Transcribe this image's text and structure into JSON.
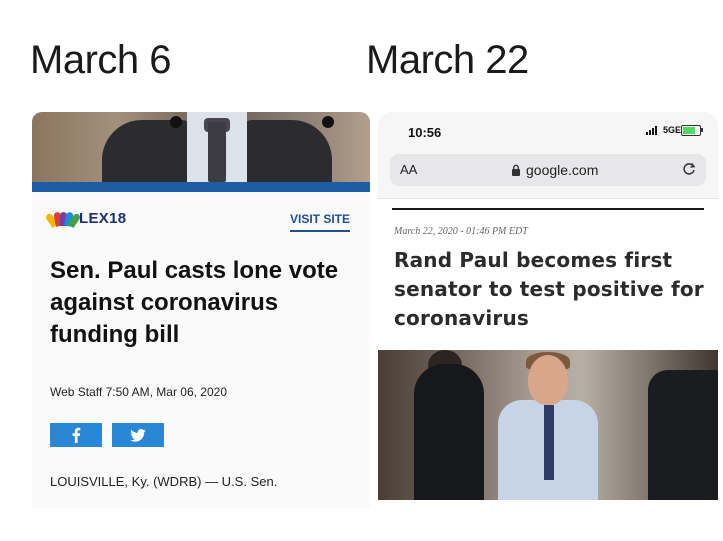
{
  "labels": {
    "left_date": "March 6",
    "right_date": "March 22"
  },
  "left_article": {
    "logo_text": "LEX18",
    "visit_site": "VISIT SITE",
    "headline": "Sen. Paul casts lone vote against coronavirus funding bill",
    "byline": "Web Staff 7:50 AM, Mar 06, 2020",
    "share_buttons": [
      "facebook-icon",
      "twitter-icon"
    ],
    "dateline": "LOUISVILLE, Ky. (WDRB) — U.S. Sen.",
    "brand_blue": "#1d5da3",
    "share_color": "#2a87d8"
  },
  "right_article": {
    "status_time": "10:56",
    "network": "5GE",
    "text_size_label": "AA",
    "domain": "google.com",
    "date": "March 22, 2020 - 01:46 PM EDT",
    "headline": "Rand Paul becomes first senator to test positive for coronavirus"
  }
}
